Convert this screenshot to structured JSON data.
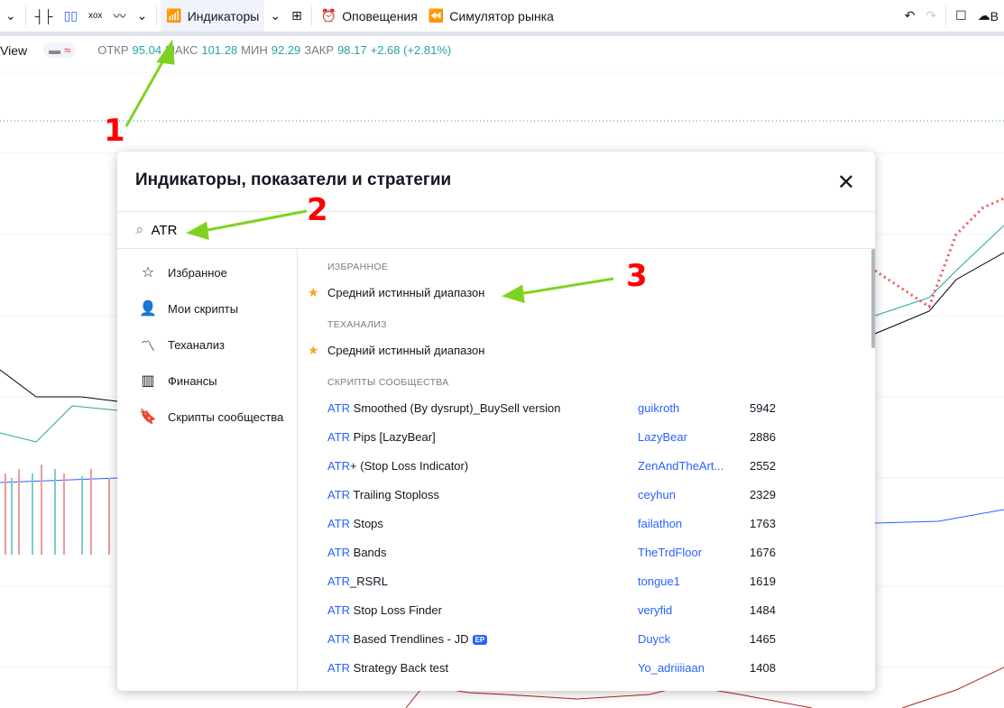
{
  "toolbar": {
    "indicators": "Индикаторы",
    "alerts": "Оповещения",
    "replay": "Симулятор рынка",
    "cut_label": "В"
  },
  "legend": {
    "name": "View",
    "open_label": "ОТКР",
    "open": "95.04",
    "high_label": "МАКС",
    "high": "101.28",
    "low_label": "МИН",
    "low": "92.29",
    "close_label": "ЗАКР",
    "close": "98.17",
    "change": "+2.68 (+2.81%)"
  },
  "dialog": {
    "title": "Индикаторы, показатели и стратегии",
    "search_value": "ATR",
    "sidebar": [
      {
        "label": "Избранное",
        "icon": "star-icon"
      },
      {
        "label": "Мои скрипты",
        "icon": "user-icon"
      },
      {
        "label": "Теханализ",
        "icon": "chart-icon"
      },
      {
        "label": "Финансы",
        "icon": "bar-chart-icon"
      },
      {
        "label": "Скрипты сообщества",
        "icon": "bookmark-icon"
      }
    ],
    "favorites_header": "ИЗБРАННОЕ",
    "favorites": [
      "Средний истинный диапазон"
    ],
    "technical_header": "ТЕХАНАЛИЗ",
    "technical": [
      "Средний истинный диапазон"
    ],
    "community_header": "СКРИПТЫ СООБЩЕСТВА",
    "community": [
      {
        "prefix": "ATR",
        "name": " Smoothed (By dysrupt)_BuySell version",
        "author": "guikroth",
        "likes": "5942"
      },
      {
        "prefix": "ATR",
        "name": " Pips [LazyBear]",
        "author": "LazyBear",
        "likes": "2886"
      },
      {
        "prefix": "ATR",
        "name": "+ (Stop Loss Indicator)",
        "author": "ZenAndTheArt...",
        "likes": "2552"
      },
      {
        "prefix": "ATR",
        "name": " Trailing Stoploss",
        "author": "ceyhun",
        "likes": "2329"
      },
      {
        "prefix": "ATR",
        "name": " Stops",
        "author": "failathon",
        "likes": "1763"
      },
      {
        "prefix": "ATR",
        "name": " Bands",
        "author": "TheTrdFloor",
        "likes": "1676"
      },
      {
        "prefix": "ATR",
        "name": "_RSRL",
        "author": "tongue1",
        "likes": "1619"
      },
      {
        "prefix": "ATR",
        "name": " Stop Loss Finder",
        "author": "veryfid",
        "likes": "1484"
      },
      {
        "prefix": "ATR",
        "name": " Based Trendlines - JD",
        "author": "Duyck",
        "likes": "1465",
        "badge": "EP"
      },
      {
        "prefix": "ATR",
        "name": " Strategy Back test",
        "author": "Yo_adriiiiaan",
        "likes": "1408"
      }
    ]
  },
  "annotations": [
    "1",
    "2",
    "3"
  ],
  "colors": {
    "accent": "#2962ff",
    "up": "#26a69a",
    "down": "#ef5350",
    "annotation": "#ff0000",
    "arrow": "#7ed321"
  }
}
